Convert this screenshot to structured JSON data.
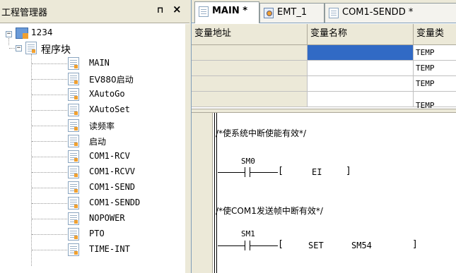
{
  "project_manager": {
    "title": "工程管理器",
    "pin_glyph": "⊓",
    "close_glyph": "×",
    "project": {
      "name": "1234",
      "expander": "⊟",
      "program_block": {
        "label": "程序块",
        "expander": "⊟",
        "items": [
          "MAIN",
          "EV880启动",
          "XAutoGo",
          "XAutoSet",
          "读频率",
          "启动",
          "COM1-RCV",
          "COM1-RCVV",
          "COM1-SEND",
          "COM1-SENDD",
          "NOPOWER",
          "PTO",
          "TIME-INT"
        ]
      }
    }
  },
  "tabs": [
    {
      "label": "MAIN *",
      "active": true,
      "icon": "program-icon"
    },
    {
      "label": "EMT_1",
      "active": false,
      "icon": "config-icon"
    },
    {
      "label": "COM1-SENDD *",
      "active": false,
      "icon": "program-icon"
    }
  ],
  "variable_table": {
    "headers": [
      "变量地址",
      "变量名称",
      "变量类"
    ],
    "rows": [
      {
        "type": "TEMP"
      },
      {
        "type": "TEMP"
      },
      {
        "type": "TEMP"
      },
      {
        "type": "TEMP"
      }
    ]
  },
  "ladder": {
    "networks": [
      {
        "comment": "/*使系统中断使能有效*/",
        "contact": "SM0",
        "instruction": "EI",
        "operand": ""
      },
      {
        "comment": "/*使COM1发送帧中断有效*/",
        "contact": "SM1",
        "instruction": "SET",
        "operand": "SM54"
      }
    ]
  },
  "colors": {
    "selection": "#316ac5",
    "chrome": "#ece9d8"
  }
}
